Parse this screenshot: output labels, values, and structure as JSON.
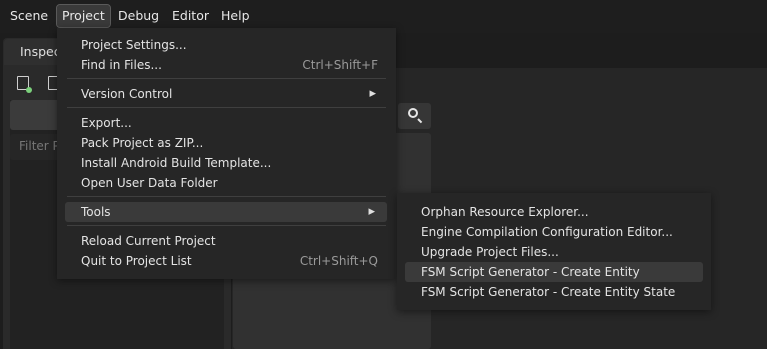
{
  "menubar": {
    "items": [
      "Scene",
      "Project",
      "Debug",
      "Editor",
      "Help"
    ]
  },
  "left_dock": {
    "tab_label": "Inspec",
    "filter_placeholder": "Filter P"
  },
  "project_menu": {
    "items": [
      {
        "label": "Project Settings...",
        "shortcut": ""
      },
      {
        "label": "Find in Files...",
        "shortcut": "Ctrl+Shift+F"
      },
      {
        "label": "Version Control",
        "shortcut": "",
        "has_submenu": true
      },
      {
        "label": "Export...",
        "shortcut": ""
      },
      {
        "label": "Pack Project as ZIP...",
        "shortcut": ""
      },
      {
        "label": "Install Android Build Template...",
        "shortcut": ""
      },
      {
        "label": "Open User Data Folder",
        "shortcut": ""
      },
      {
        "label": "Tools",
        "shortcut": "",
        "has_submenu": true,
        "highlighted": true
      },
      {
        "label": "Reload Current Project",
        "shortcut": ""
      },
      {
        "label": "Quit to Project List",
        "shortcut": "Ctrl+Shift+Q"
      }
    ]
  },
  "tools_submenu": {
    "items": [
      {
        "label": "Orphan Resource Explorer..."
      },
      {
        "label": "Engine Compilation Configuration Editor..."
      },
      {
        "label": "Upgrade Project Files..."
      },
      {
        "label": "FSM Script Generator - Create Entity",
        "highlighted": true
      },
      {
        "label": "FSM Script Generator - Create Entity State"
      }
    ]
  },
  "icons": {
    "arrow": "▸",
    "search": "search-icon"
  },
  "colors": {
    "background": "#1d1d1d",
    "menu_bg": "#262626",
    "highlight": "#3a3a3a"
  }
}
